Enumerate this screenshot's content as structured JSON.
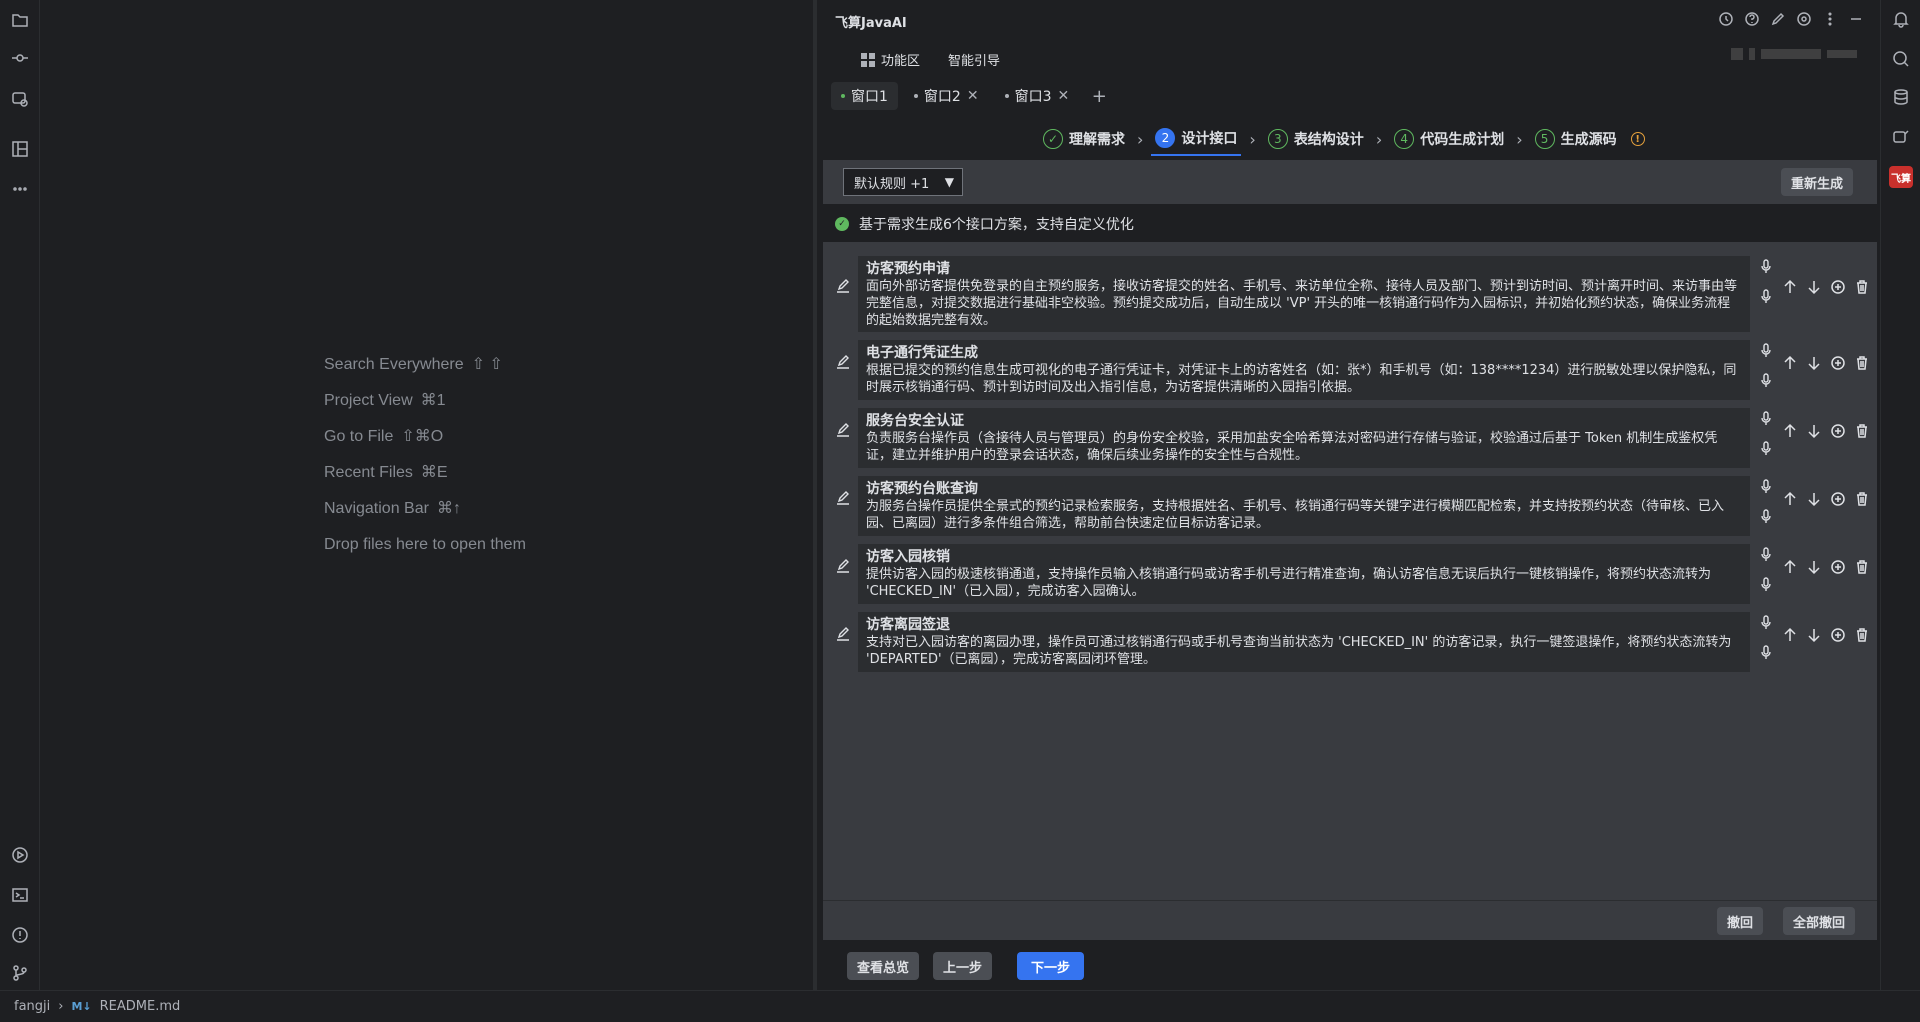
{
  "editor": {
    "hints": [
      {
        "label": "Search Everywhere",
        "key": "⇧ ⇧"
      },
      {
        "label": "Project View",
        "key": "⌘1"
      },
      {
        "label": "Go to File",
        "key": "⇧⌘O"
      },
      {
        "label": "Recent Files",
        "key": "⌘E"
      },
      {
        "label": "Navigation Bar",
        "key": "⌘↑"
      },
      {
        "label": "Drop files here to open them",
        "key": ""
      }
    ]
  },
  "panel": {
    "title": "飞算JavaAI",
    "nav": {
      "features": "功能区",
      "guide": "智能引导"
    },
    "tabs": [
      {
        "label": "窗口1",
        "active": true,
        "closable": false
      },
      {
        "label": "窗口2",
        "active": false,
        "closable": true
      },
      {
        "label": "窗口3",
        "active": false,
        "closable": true
      }
    ],
    "steps": [
      {
        "num": "✓",
        "label": "理解需求",
        "state": "done"
      },
      {
        "num": "2",
        "label": "设计接口",
        "state": "current"
      },
      {
        "num": "3",
        "label": "表结构设计",
        "state": "todo"
      },
      {
        "num": "4",
        "label": "代码生成计划",
        "state": "todo"
      },
      {
        "num": "5",
        "label": "生成源码",
        "state": "todo"
      }
    ],
    "rule_select": "默认规则 +1",
    "regen_label": "重新生成",
    "info_text": "基于需求生成6个接口方案，支持自定义优化",
    "items": [
      {
        "title": "访客预约申请",
        "desc": "面向外部访客提供免登录的自主预约服务，接收访客提交的姓名、手机号、来访单位全称、接待人员及部门、预计到访时间、预计离开时间、来访事由等完整信息，对提交数据进行基础非空校验。预约提交成功后，自动生成以 'VP' 开头的唯一核销通行码作为入园标识，并初始化预约状态，确保业务流程的起始数据完整有效。"
      },
      {
        "title": "电子通行凭证生成",
        "desc": "根据已提交的预约信息生成可视化的电子通行凭证卡，对凭证卡上的访客姓名（如：张*）和手机号（如：138****1234）进行脱敏处理以保护隐私，同时展示核销通行码、预计到访时间及出入指引信息，为访客提供清晰的入园指引依据。"
      },
      {
        "title": "服务台安全认证",
        "desc": "负责服务台操作员（含接待人员与管理员）的身份安全校验，采用加盐安全哈希算法对密码进行存储与验证，校验通过后基于 Token 机制生成鉴权凭证，建立并维护用户的登录会话状态，确保后续业务操作的安全性与合规性。"
      },
      {
        "title": "访客预约台账查询",
        "desc": "为服务台操作员提供全景式的预约记录检索服务，支持根据姓名、手机号、核销通行码等关键字进行模糊匹配检索，并支持按预约状态（待审核、已入园、已离园）进行多条件组合筛选，帮助前台快速定位目标访客记录。"
      },
      {
        "title": "访客入园核销",
        "desc": "提供访客入园的极速核销通道，支持操作员输入核销通行码或访客手机号进行精准查询，确认访客信息无误后执行一键核销操作，将预约状态流转为 'CHECKED_IN'（已入园），完成访客入园确认。"
      },
      {
        "title": "访客离园签退",
        "desc": "支持对已入园访客的离园办理，操作员可通过核销通行码或手机号查询当前状态为 'CHECKED_IN' 的访客记录，执行一键签退操作，将预约状态流转为 'DEPARTED'（已离园），完成访客离园闭环管理。"
      }
    ],
    "undo_label": "撤回",
    "undo_all_label": "全部撤回",
    "overview_label": "查看总览",
    "prev_label": "上一步",
    "next_label": "下一步",
    "brand_badge": "飞算"
  },
  "status": {
    "project": "fangji",
    "file_badge": "M↓",
    "file": "README.md"
  },
  "colors": {
    "accent": "#3574f0",
    "success": "#5fb85f",
    "warning": "#e5a03c",
    "brand": "#c9302c"
  }
}
